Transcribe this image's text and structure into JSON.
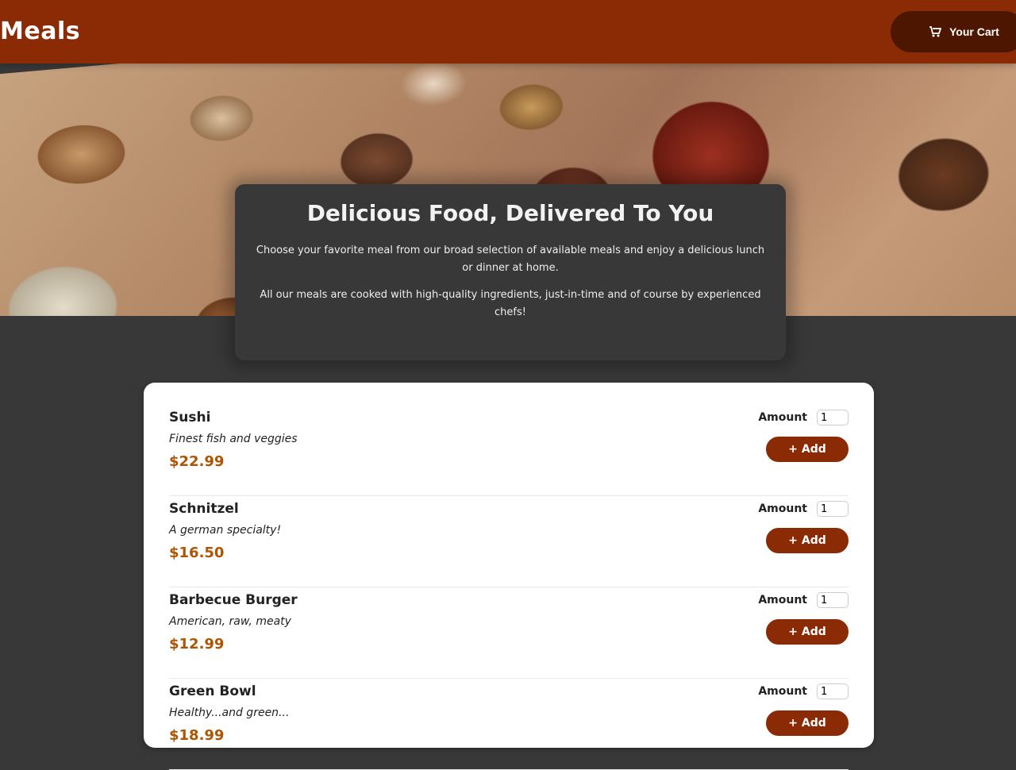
{
  "header": {
    "brand": "Meals",
    "cart_label": "Your Cart",
    "cart_icon": "cart-icon"
  },
  "summary": {
    "title": "Delicious Food, Delivered To You",
    "paragraph1": "Choose your favorite meal from our broad selection of available meals and enjoy a delicious lunch or dinner at home.",
    "paragraph2": "All our meals are cooked with high-quality ingredients, just-in-time and of course by experienced chefs!"
  },
  "meals": [
    {
      "name": "Sushi",
      "description": "Finest fish and veggies",
      "price": "$22.99",
      "amount_label": "Amount",
      "amount_value": "1",
      "add_label": "+ Add"
    },
    {
      "name": "Schnitzel",
      "description": "A german specialty!",
      "price": "$16.50",
      "amount_label": "Amount",
      "amount_value": "1",
      "add_label": "+ Add"
    },
    {
      "name": "Barbecue Burger",
      "description": "American, raw, meaty",
      "price": "$12.99",
      "amount_label": "Amount",
      "amount_value": "1",
      "add_label": "+ Add"
    },
    {
      "name": "Green Bowl",
      "description": "Healthy...and green...",
      "price": "$18.99",
      "amount_label": "Amount",
      "amount_value": "1",
      "add_label": "+ Add"
    }
  ],
  "colors": {
    "header": "#8a2b06",
    "cart_button": "#4d1601",
    "background": "#383838",
    "price": "#ad5502"
  }
}
